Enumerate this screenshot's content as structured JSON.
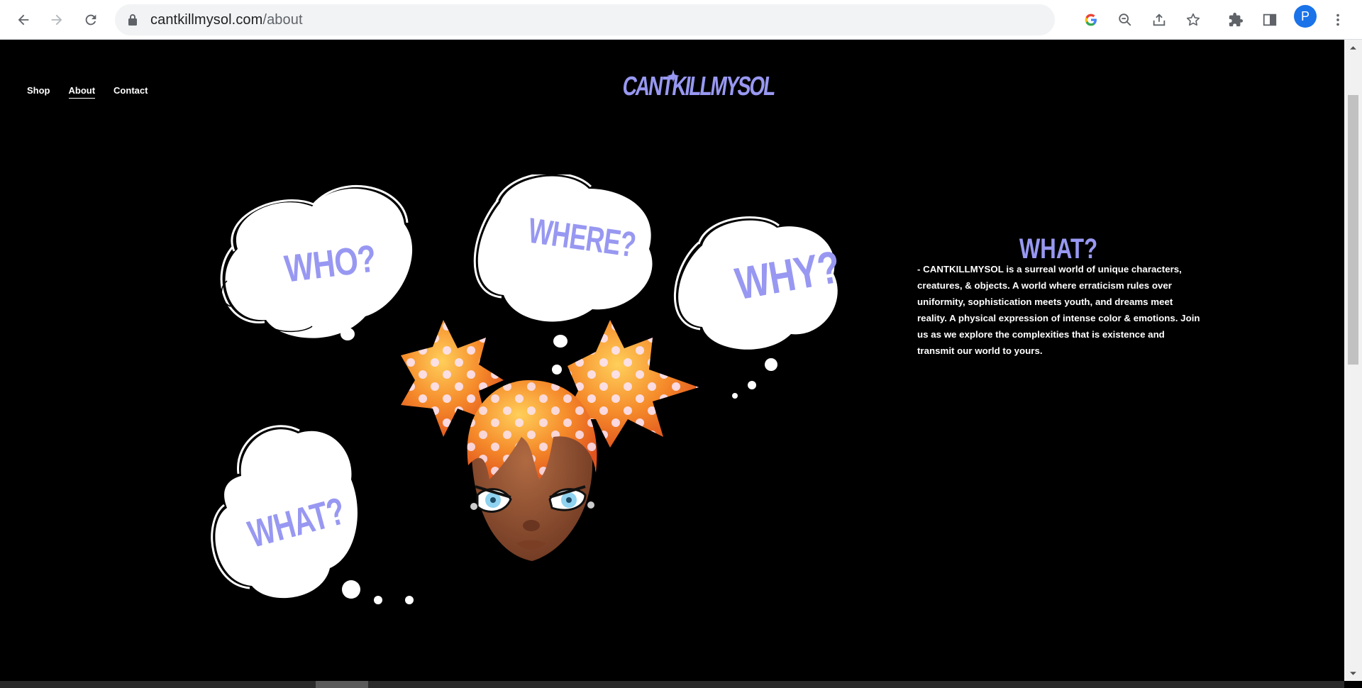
{
  "browser": {
    "url_domain": "cantkillmysol.com",
    "url_path": "/about",
    "profile_initial": "P",
    "icons": [
      "back-icon",
      "forward-icon",
      "reload-icon",
      "lock-icon",
      "google-icon",
      "zoom-out-icon",
      "share-icon",
      "star-icon",
      "extensions-icon",
      "side-panel-icon",
      "menu-icon"
    ]
  },
  "site": {
    "nav": {
      "shop": "Shop",
      "about": "About",
      "contact": "Contact"
    },
    "logo_text": "CANTKILLMYSOL",
    "bubbles": {
      "who": "WHO?",
      "where": "WHERE?",
      "why": "WHY?",
      "what": "WHAT?"
    },
    "about": {
      "title": "WHAT?",
      "body": "- CANTKILLMYSOL is a surreal world of unique characters, creatures, & objects. A world where erraticism rules over uniformity, sophistication meets youth, and dreams meet reality. A physical expression of intense color & emotions. Join us as we explore the complexities that is existence and transmit our world to yours."
    }
  },
  "colors": {
    "accent_lavender": "#9898f2",
    "background": "#000000",
    "character_orange": "#f08a2c",
    "character_skin": "#8a4a2c",
    "polka_dot": "#f5c6e8",
    "eye_blue": "#8fd3f0"
  }
}
